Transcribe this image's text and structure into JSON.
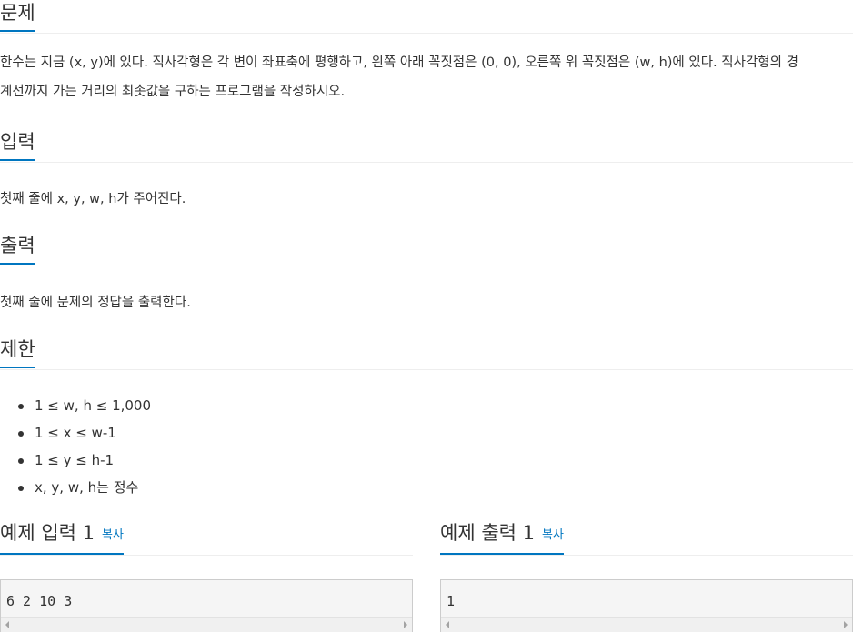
{
  "problem": {
    "title": "문제",
    "lines": [
      "한수는 지금 (x, y)에 있다. 직사각형은 각 변이 좌표축에 평행하고, 왼쪽 아래 꼭짓점은 (0, 0), 오른쪽 위 꼭짓점은 (w, h)에 있다. 직사각형의 경",
      "계선까지 가는 거리의 최솟값을 구하는 프로그램을 작성하시오."
    ]
  },
  "input": {
    "title": "입력",
    "text": "첫째 줄에 x, y, w, h가 주어진다."
  },
  "output": {
    "title": "출력",
    "text": "첫째 줄에 문제의 정답을 출력한다."
  },
  "limits": {
    "title": "제한",
    "items": [
      "1 ≤ w, h ≤ 1,000",
      "1 ≤ x ≤ w-1",
      "1 ≤ y ≤ h-1",
      "x, y, w, h는 정수"
    ]
  },
  "sample_input": {
    "title": "예제 입력 1",
    "copy_label": "복사",
    "content": "6 2 10 3"
  },
  "sample_output": {
    "title": "예제 출력 1",
    "copy_label": "복사",
    "content": "1"
  }
}
